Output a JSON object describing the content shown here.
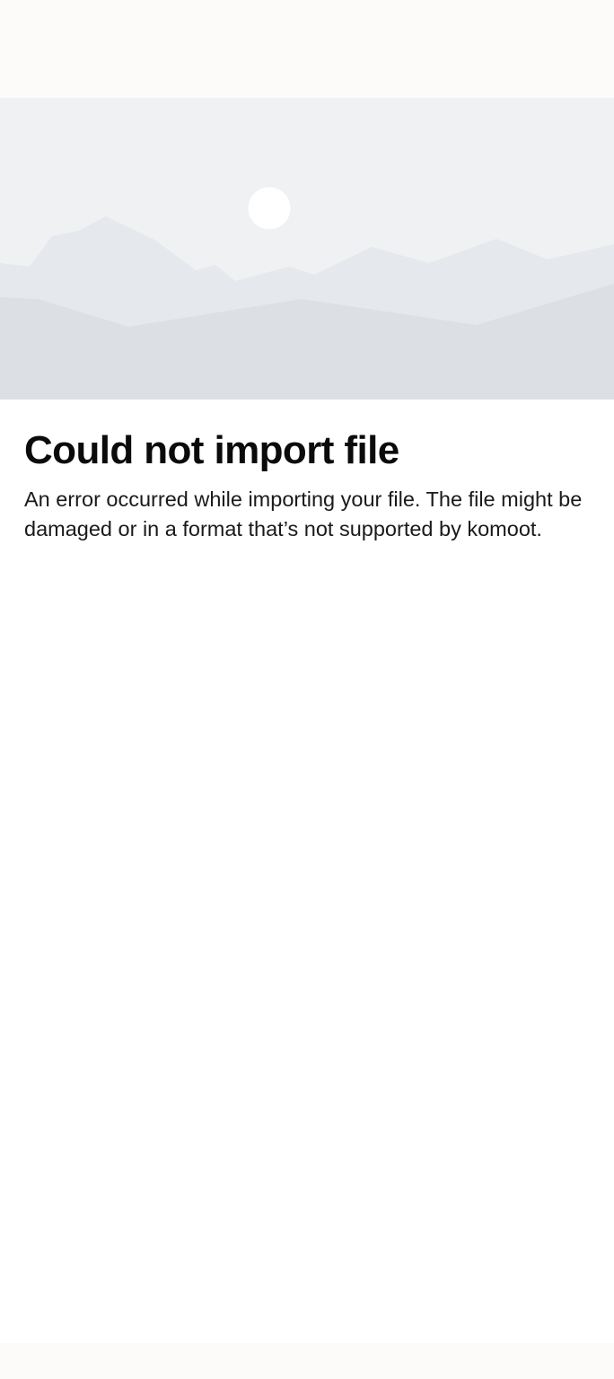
{
  "error": {
    "illustration_icon": "mountain-landscape-placeholder",
    "title": "Could not import file",
    "message": "An error occurred while importing your file. The file might be damaged or in a format that’s not supported by komoot."
  },
  "colors": {
    "top_bar": "#fcfbf9",
    "sky": "#f0f1f3",
    "sun": "#ffffff",
    "mountains_back": "#e5e8ec",
    "mountains_front": "#dcdfe3",
    "title_text": "#0b0b0b",
    "body_text": "#1a1a1a"
  }
}
